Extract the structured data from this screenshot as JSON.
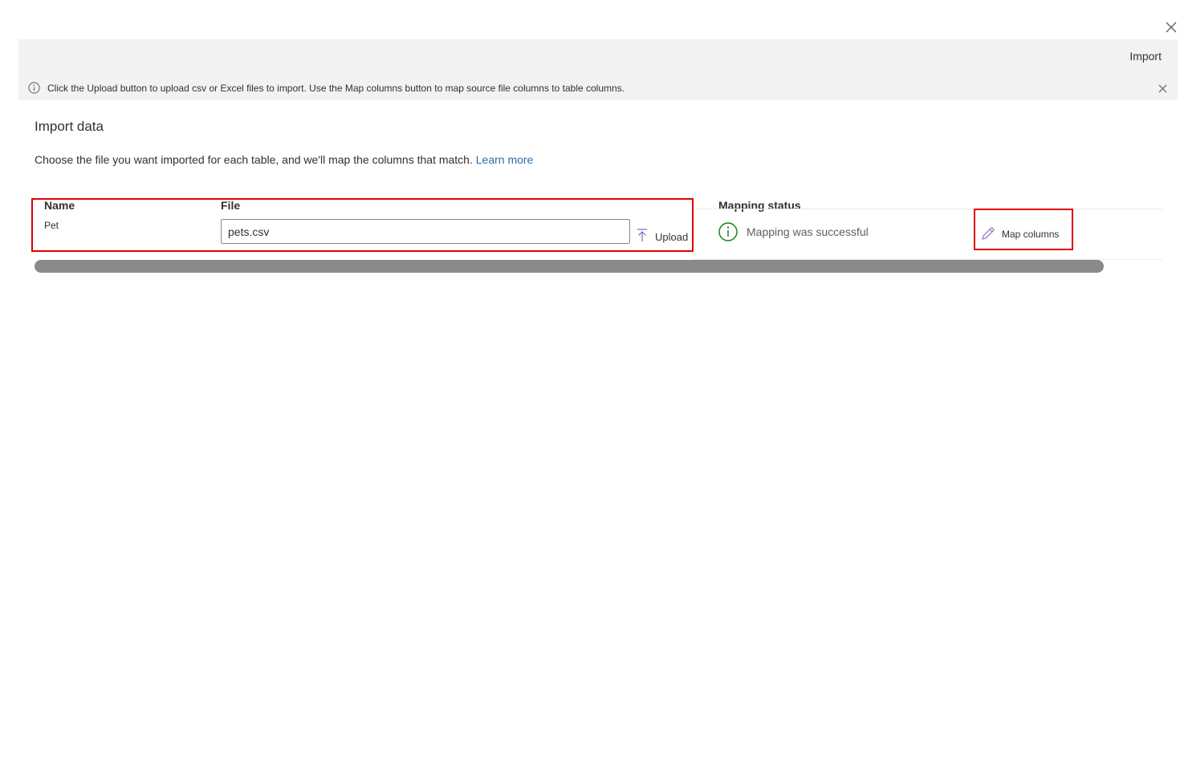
{
  "command_bar": {
    "import_label": "Import"
  },
  "infobar": {
    "message": "Click the Upload button to upload csv or Excel files to import. Use the Map columns button to map source file columns to table columns.",
    "icon": "info-icon"
  },
  "page": {
    "title": "Import data",
    "description": "Choose the file you want imported for each table, and we'll map the columns that match.",
    "learn_more": "Learn more"
  },
  "table": {
    "headers": {
      "name": "Name",
      "file": "File",
      "status": "Mapping status"
    },
    "rows": [
      {
        "name": "Pet",
        "file": "pets.csv",
        "upload_label": "Upload",
        "status": "Mapping was successful",
        "map_label": "Map columns"
      }
    ]
  },
  "colors": {
    "accent": "#8764b8",
    "success": "#107c10",
    "link": "#2b6cb0",
    "highlight": "#e00000"
  }
}
